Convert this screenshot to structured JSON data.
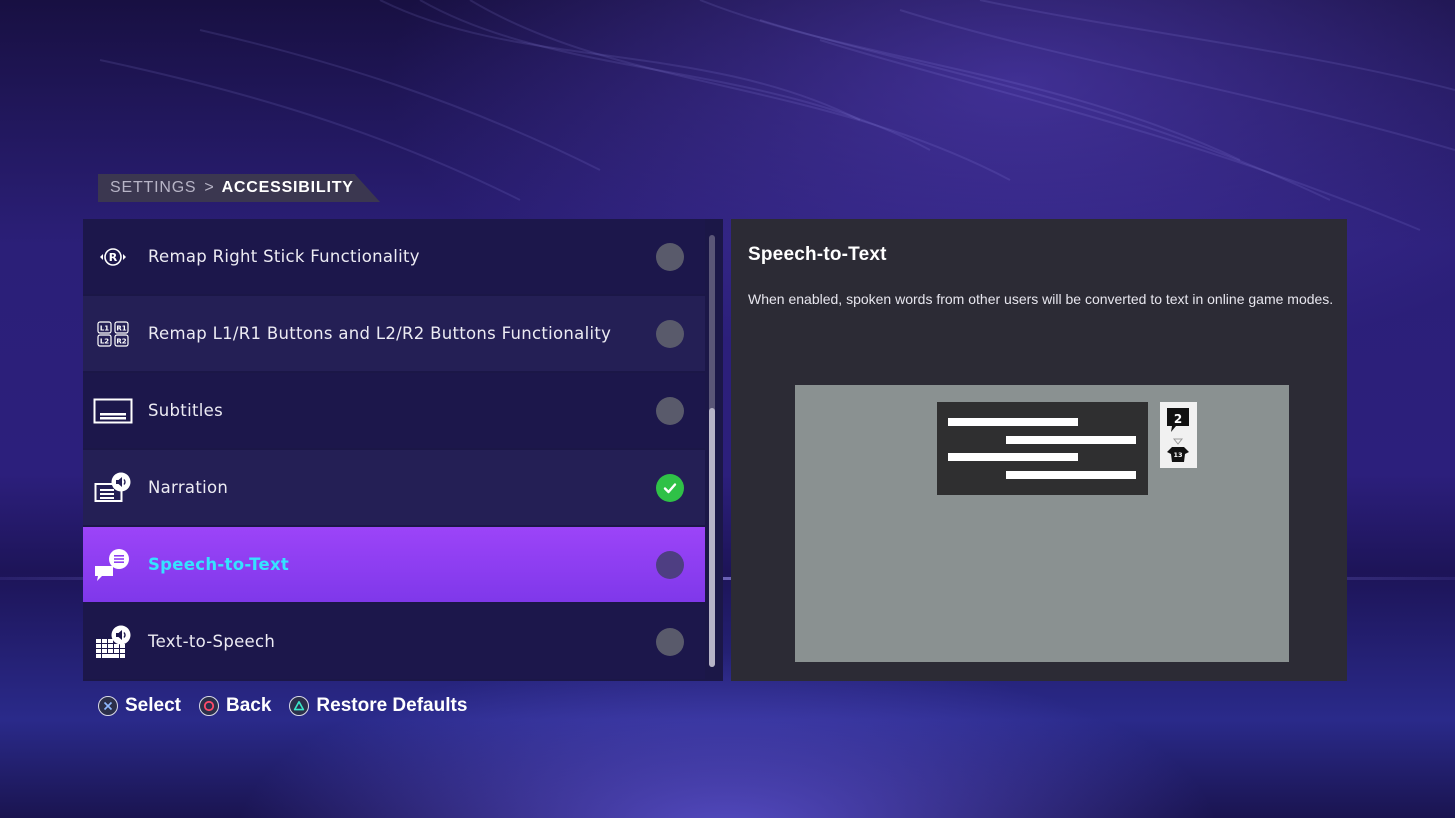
{
  "breadcrumb": {
    "parent": "SETTINGS",
    "current": "ACCESSIBILITY"
  },
  "settings_list": {
    "items": [
      {
        "label": "Remap Right Stick Functionality",
        "icon": "right-stick-icon",
        "enabled": false,
        "selected": false
      },
      {
        "label": "Remap L1/R1 Buttons and L2/R2 Buttons Functionality",
        "icon": "shoulder-buttons-icon",
        "enabled": false,
        "selected": false
      },
      {
        "label": "Subtitles",
        "icon": "subtitles-icon",
        "enabled": false,
        "selected": false
      },
      {
        "label": "Narration",
        "icon": "narration-icon",
        "enabled": true,
        "selected": false
      },
      {
        "label": "Speech-to-Text",
        "icon": "speech-to-text-icon",
        "enabled": false,
        "selected": true
      },
      {
        "label": "Text-to-Speech",
        "icon": "text-to-speech-icon",
        "enabled": false,
        "selected": false
      }
    ],
    "scroll_position": 0.4
  },
  "icon_glyphs": {
    "stick_letter": "R",
    "l1": "L1",
    "r1": "R1",
    "l2": "L2",
    "r2": "R2"
  },
  "detail": {
    "title": "Speech-to-Text",
    "description": "When enabled, spoken words from other users will be converted to text in online game modes.",
    "preview_badge_number": "2",
    "preview_player_number": "13"
  },
  "button_hints": [
    {
      "button": "cross-button-icon",
      "label": "Select",
      "color": "#8fb8ff"
    },
    {
      "button": "circle-button-icon",
      "label": "Back",
      "color": "#ff4a6a"
    },
    {
      "button": "triangle-button-icon",
      "label": "Restore Defaults",
      "color": "#39e6c8"
    }
  ],
  "colors": {
    "selected_row": "#8f3ff2",
    "selected_text": "#35e3ff",
    "toggle_on": "#2fc147",
    "toggle_off": "#595a6b"
  }
}
